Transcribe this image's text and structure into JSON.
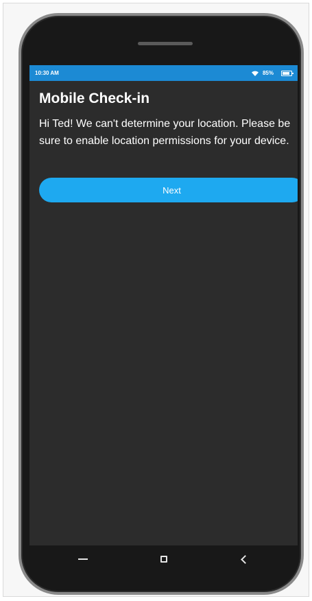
{
  "status_bar": {
    "time": "10:30 AM",
    "battery_percent": "85%",
    "battery_level": 0.85,
    "background_color": "#1c8ad4",
    "icons": [
      "wifi-icon",
      "battery-icon"
    ]
  },
  "screen": {
    "title": "Mobile Check-in",
    "message": "Hi Ted! We can't determine your location. Please be sure to enable location permissions for your device.",
    "next_label": "Next",
    "button_color": "#1ea9f0",
    "background_color": "#2c2c2c"
  },
  "nav_bar": {
    "icons": [
      "menu-icon",
      "home-icon",
      "back-icon"
    ]
  }
}
